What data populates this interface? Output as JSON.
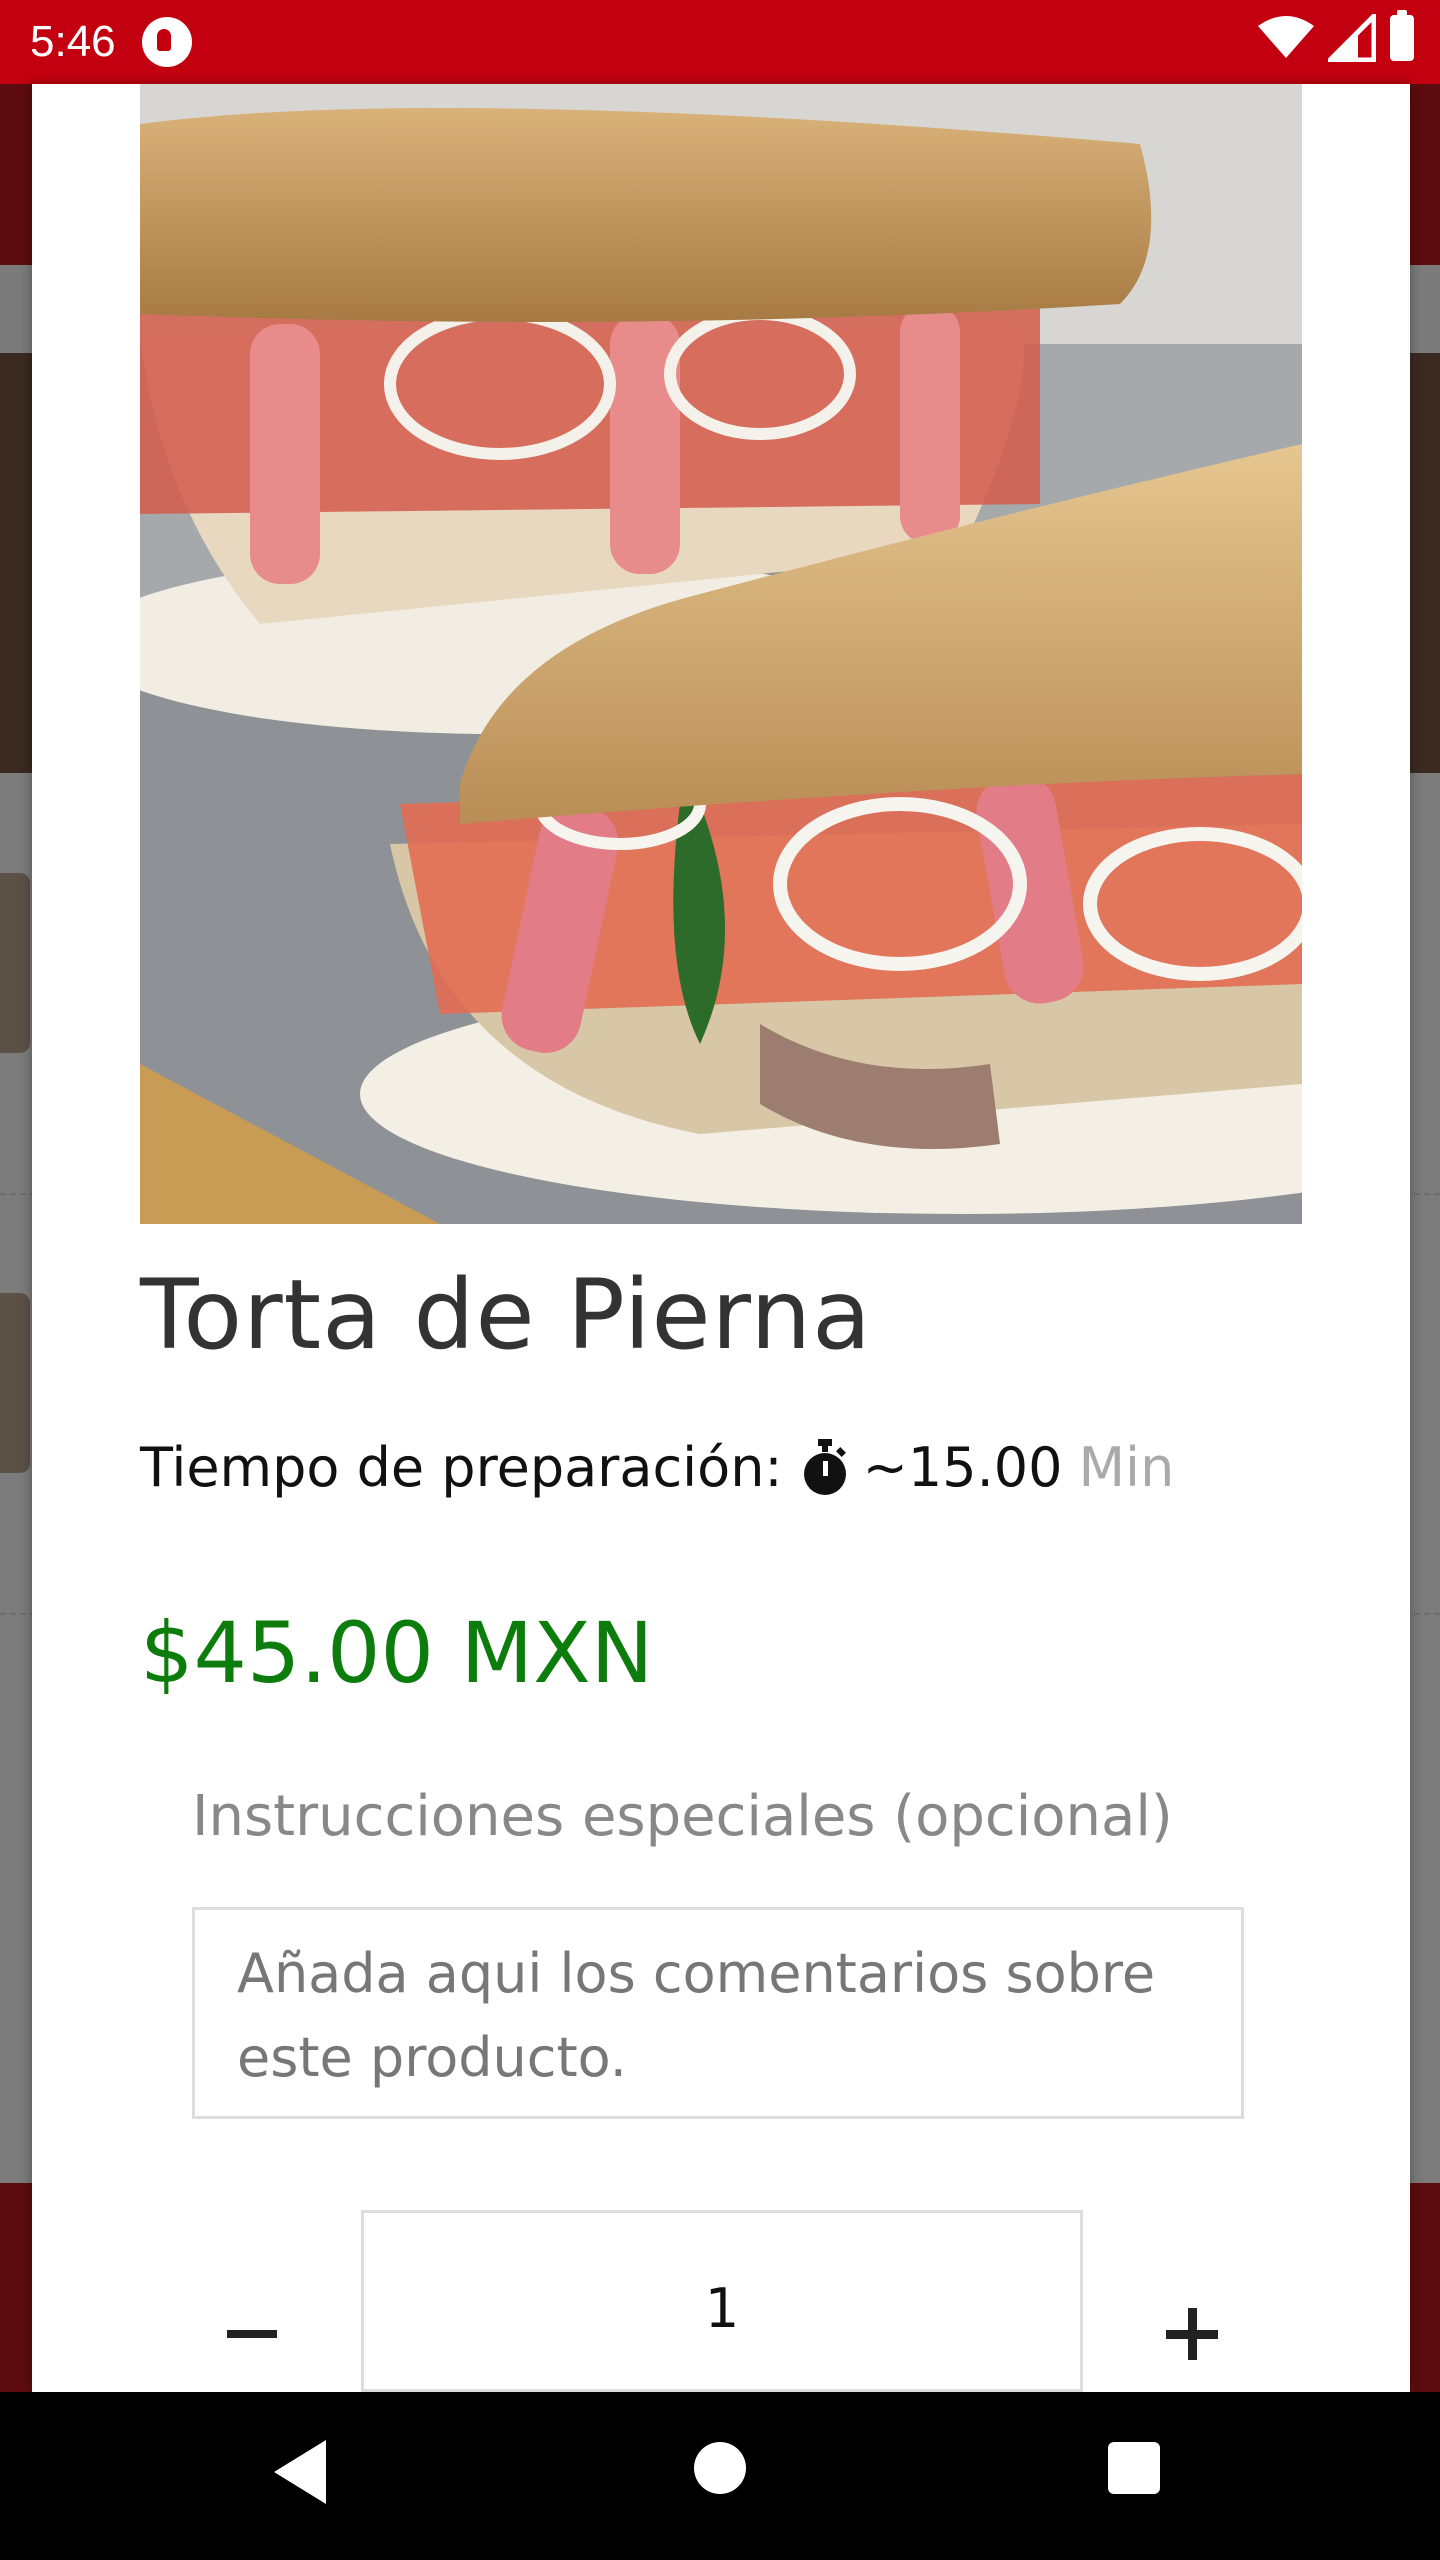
{
  "status_bar": {
    "time": "5:46",
    "color": "#c30010",
    "icons": [
      "app-notification-icon",
      "wifi-icon",
      "signal-icon",
      "battery-icon"
    ]
  },
  "product": {
    "image_icon": "sandwich-photo",
    "title": "Torta de Pierna",
    "prep_label": "Tiempo de preparación:",
    "prep_icon": "stopwatch-icon",
    "prep_time": "~15.00",
    "prep_unit": "Min",
    "price": "$45.00 MXN",
    "price_color": "#0c7d0c"
  },
  "instructions": {
    "label": "Instrucciones especiales (opcional)",
    "placeholder": "Añada aqui los comentarios sobre este producto.",
    "value": ""
  },
  "quantity": {
    "value": "1",
    "minus_icon": "minus-icon",
    "plus_icon": "plus-icon"
  },
  "nav_bar": {
    "icons": [
      "back-icon",
      "home-icon",
      "recents-icon"
    ]
  }
}
